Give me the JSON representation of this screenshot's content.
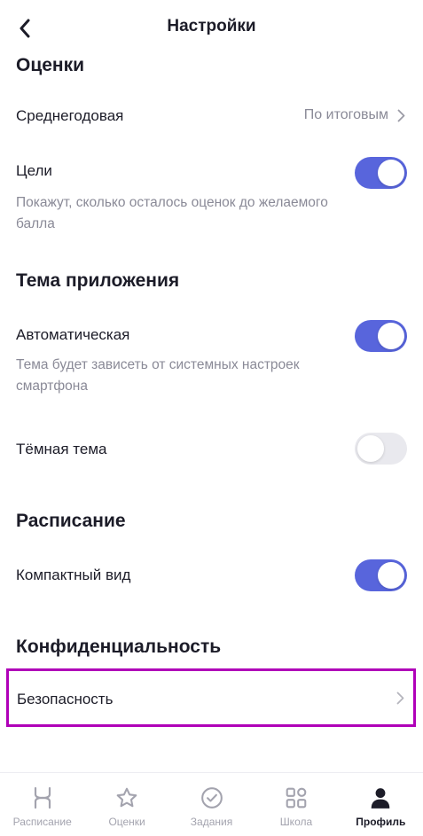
{
  "header": {
    "title": "Настройки"
  },
  "sections": {
    "grades": {
      "title": "Оценки",
      "average": {
        "label": "Среднегодовая",
        "value": "По итоговым"
      },
      "goals": {
        "label": "Цели",
        "description": "Покажут, сколько осталось оценок до желаемого балла",
        "enabled": true
      }
    },
    "theme": {
      "title": "Тема приложения",
      "auto": {
        "label": "Автоматическая",
        "description": "Тема будет зависеть от системных настроек смартфона",
        "enabled": true
      },
      "dark": {
        "label": "Тёмная тема",
        "enabled": false
      }
    },
    "schedule": {
      "title": "Расписание",
      "compact": {
        "label": "Компактный вид",
        "enabled": true
      }
    },
    "privacy": {
      "title": "Конфиденциальность",
      "security": {
        "label": "Безопасность"
      }
    }
  },
  "tabbar": {
    "tabs": [
      {
        "label": "Расписание",
        "icon": "schedule-icon",
        "active": false
      },
      {
        "label": "Оценки",
        "icon": "star-icon",
        "active": false
      },
      {
        "label": "Задания",
        "icon": "check-circle-icon",
        "active": false
      },
      {
        "label": "Школа",
        "icon": "grid-icon",
        "active": false
      },
      {
        "label": "Профиль",
        "icon": "person-icon",
        "active": true
      }
    ]
  },
  "colors": {
    "accent": "#5865dc",
    "highlight": "#b000b8",
    "muted": "#8a8a97",
    "text": "#1c1c28"
  }
}
